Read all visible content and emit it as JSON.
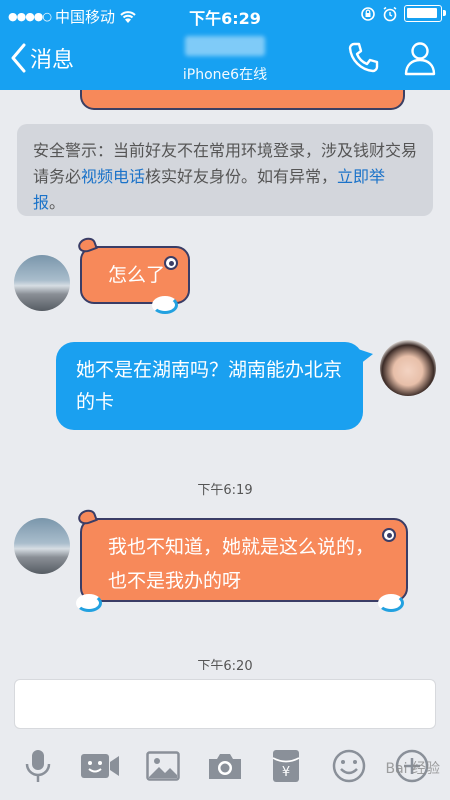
{
  "status_bar": {
    "carrier": "中国移动",
    "time": "下午6:29"
  },
  "nav": {
    "back_label": "消息",
    "contact_status": "iPhone6在线"
  },
  "notice": {
    "text_before": "安全警示：当前好友不在常用环境登录，涉及钱财交易请务必",
    "link1": "视频电话",
    "text_middle": "核实好友身份。如有异常，",
    "link2": "立即举报",
    "text_after": "。"
  },
  "messages": [
    {
      "side": "left",
      "text": "怎么了"
    },
    {
      "side": "right",
      "text": "她不是在湖南吗？湖南能办北京的卡"
    },
    {
      "side": "left",
      "text": "我也不知道，她就是这么说的，也不是我办的呀"
    }
  ],
  "timestamps": [
    "下午6:19",
    "下午6:20"
  ],
  "toolbar": {
    "icons": [
      "mic-icon",
      "video-icon",
      "image-icon",
      "camera-icon",
      "red-packet-icon",
      "emoji-icon",
      "plus-icon"
    ]
  },
  "watermark": "Bai 经验"
}
